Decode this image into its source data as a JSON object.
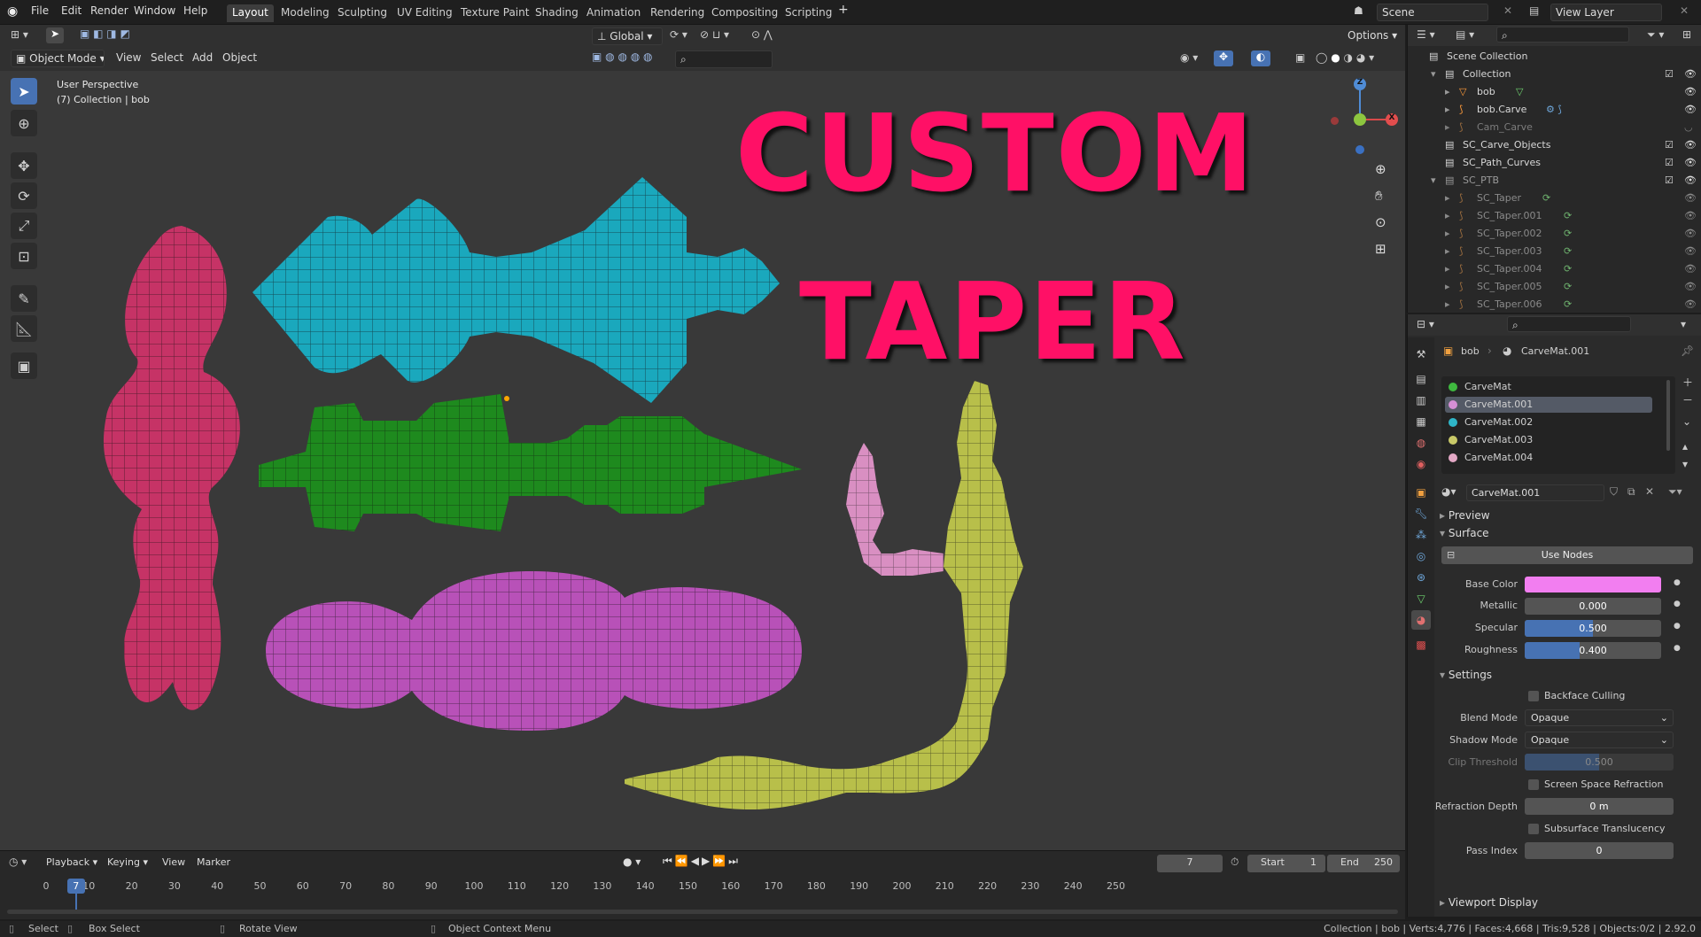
{
  "topbar": {
    "menus": [
      "File",
      "Edit",
      "Render",
      "Window",
      "Help"
    ],
    "workspace_tabs": [
      "Layout",
      "Modeling",
      "Sculpting",
      "UV Editing",
      "Texture Paint",
      "Shading",
      "Animation",
      "Rendering",
      "Compositing",
      "Scripting"
    ],
    "active_tab": "Layout",
    "add_tab": "+",
    "scene": "Scene",
    "view_layer": "View Layer"
  },
  "viewport_header": {
    "orientation": "Global",
    "mode": "Object Mode",
    "menus": [
      "View",
      "Select",
      "Add",
      "Object"
    ],
    "options": "Options"
  },
  "viewport": {
    "perspective": "User Perspective",
    "collection_info": "(7) Collection | bob",
    "overlay_title_line1": "CUSTOM",
    "overlay_title_line2": "TAPER",
    "gizmo": {
      "z": "Z",
      "x": "X"
    },
    "mesh_colors": {
      "red": "#c63366",
      "cyan": "#1aa8bd",
      "green": "#1e8a1e",
      "violet": "#b851b8",
      "pink": "#d98fc2",
      "olive": "#b8bf4a"
    }
  },
  "outliner": {
    "root": "Scene Collection",
    "rows": [
      {
        "label": "Collection"
      },
      {
        "label": "bob"
      },
      {
        "label": "bob.Carve"
      },
      {
        "label": "Cam_Carve"
      },
      {
        "label": "SC_Carve_Objects"
      },
      {
        "label": "SC_Path_Curves"
      },
      {
        "label": "SC_PTB"
      },
      {
        "label": "SC_Taper"
      },
      {
        "label": "SC_Taper.001"
      },
      {
        "label": "SC_Taper.002"
      },
      {
        "label": "SC_Taper.003"
      },
      {
        "label": "SC_Taper.004"
      },
      {
        "label": "SC_Taper.005"
      },
      {
        "label": "SC_Taper.006"
      }
    ]
  },
  "properties": {
    "breadcrumb_object": "bob",
    "breadcrumb_material": "CarveMat.001",
    "materials": [
      {
        "name": "CarveMat",
        "color": "#3fb83f"
      },
      {
        "name": "CarveMat.001",
        "color": "#d58fd5"
      },
      {
        "name": "CarveMat.002",
        "color": "#2fb6c8"
      },
      {
        "name": "CarveMat.003",
        "color": "#c9c968"
      },
      {
        "name": "CarveMat.004",
        "color": "#e3a8c5"
      }
    ],
    "selected_material": "CarveMat.001",
    "sections": {
      "preview": "Preview",
      "surface": "Surface",
      "settings": "Settings",
      "viewport_display": "Viewport Display"
    },
    "use_nodes": "Use Nodes",
    "base_color_label": "Base Color",
    "base_color": "#f27ef0",
    "metallic_label": "Metallic",
    "metallic": "0.000",
    "metallic_value": 0.0,
    "specular_label": "Specular",
    "specular": "0.500",
    "specular_value": 0.5,
    "roughness_label": "Roughness",
    "roughness": "0.400",
    "roughness_value": 0.4,
    "backface_culling": "Backface Culling",
    "blend_mode_label": "Blend Mode",
    "blend_mode": "Opaque",
    "shadow_mode_label": "Shadow Mode",
    "shadow_mode": "Opaque",
    "clip_threshold_label": "Clip Threshold",
    "clip_threshold": "0.500",
    "clip_threshold_value": 0.5,
    "ssr": "Screen Space Refraction",
    "refraction_depth_label": "Refraction Depth",
    "refraction_depth": "0 m",
    "subsurface_translucency": "Subsurface Translucency",
    "pass_index_label": "Pass Index",
    "pass_index": "0"
  },
  "timeline": {
    "menus": [
      "Playback",
      "Keying",
      "View",
      "Marker"
    ],
    "current_frame": "7",
    "current_frame_value": 7,
    "start_label": "Start",
    "start": "1",
    "end_label": "End",
    "end": "250",
    "ticks": [
      "0",
      "10",
      "20",
      "30",
      "40",
      "50",
      "60",
      "70",
      "80",
      "90",
      "100",
      "110",
      "120",
      "130",
      "140",
      "150",
      "160",
      "170",
      "180",
      "190",
      "200",
      "210",
      "220",
      "230",
      "240",
      "250"
    ]
  },
  "statusbar": {
    "select": "Select",
    "box_select": "Box Select",
    "rotate_view": "Rotate View",
    "context_menu": "Object Context Menu",
    "stats": "Collection | bob | Verts:4,776 | Faces:4,668 | Tris:9,528 | Objects:0/2 | 2.92.0"
  }
}
